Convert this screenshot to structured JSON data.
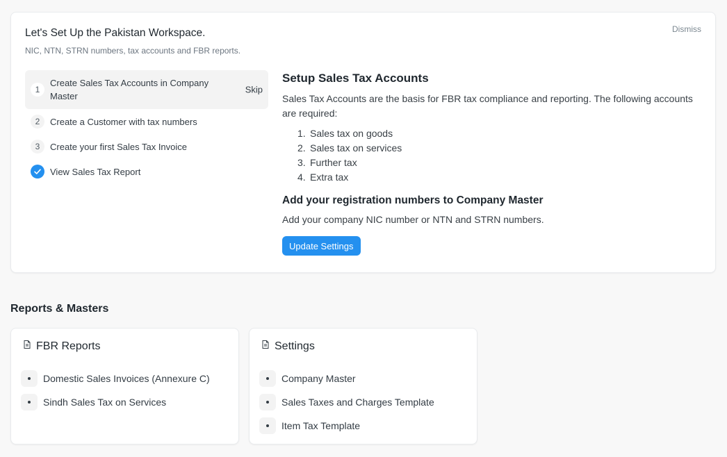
{
  "onboarding": {
    "title": "Let's Set Up the Pakistan Workspace.",
    "subtitle": "NIC, NTN, STRN numbers, tax accounts and FBR reports.",
    "dismiss_label": "Dismiss",
    "steps": [
      {
        "number": "1",
        "label": "Create Sales Tax Accounts in Company Master",
        "skip_label": "Skip",
        "state": "active"
      },
      {
        "number": "2",
        "label": "Create a Customer with tax numbers",
        "state": "pending"
      },
      {
        "number": "3",
        "label": "Create your first Sales Tax Invoice",
        "state": "pending"
      },
      {
        "number": "",
        "label": "View Sales Tax Report",
        "state": "done"
      }
    ],
    "detail": {
      "heading": "Setup Sales Tax Accounts",
      "description": "Sales Tax Accounts are the basis for FBR tax compliance and reporting. The following accounts are required:",
      "accounts": [
        {
          "n": "1.",
          "label": "Sales tax on goods"
        },
        {
          "n": "2.",
          "label": "Sales tax on services"
        },
        {
          "n": "3.",
          "label": "Further tax"
        },
        {
          "n": "4.",
          "label": "Extra tax"
        }
      ],
      "subheading": "Add your registration numbers to Company Master",
      "sub_description": "Add your company NIC number or NTN and STRN numbers.",
      "button_label": "Update Settings"
    }
  },
  "reports_section": {
    "title": "Reports & Masters",
    "cards": [
      {
        "title": "FBR Reports",
        "icon": "file-icon",
        "links": [
          "Domestic Sales Invoices (Annexure C)",
          "Sindh Sales Tax on Services"
        ]
      },
      {
        "title": "Settings",
        "icon": "file-icon",
        "links": [
          "Company Master",
          "Sales Taxes and Charges Template",
          "Item Tax Template"
        ]
      }
    ]
  },
  "colors": {
    "accent": "#2490ef",
    "card_bg": "#ffffff",
    "page_bg": "#f8f8f8",
    "muted_bg": "#f3f3f3"
  }
}
